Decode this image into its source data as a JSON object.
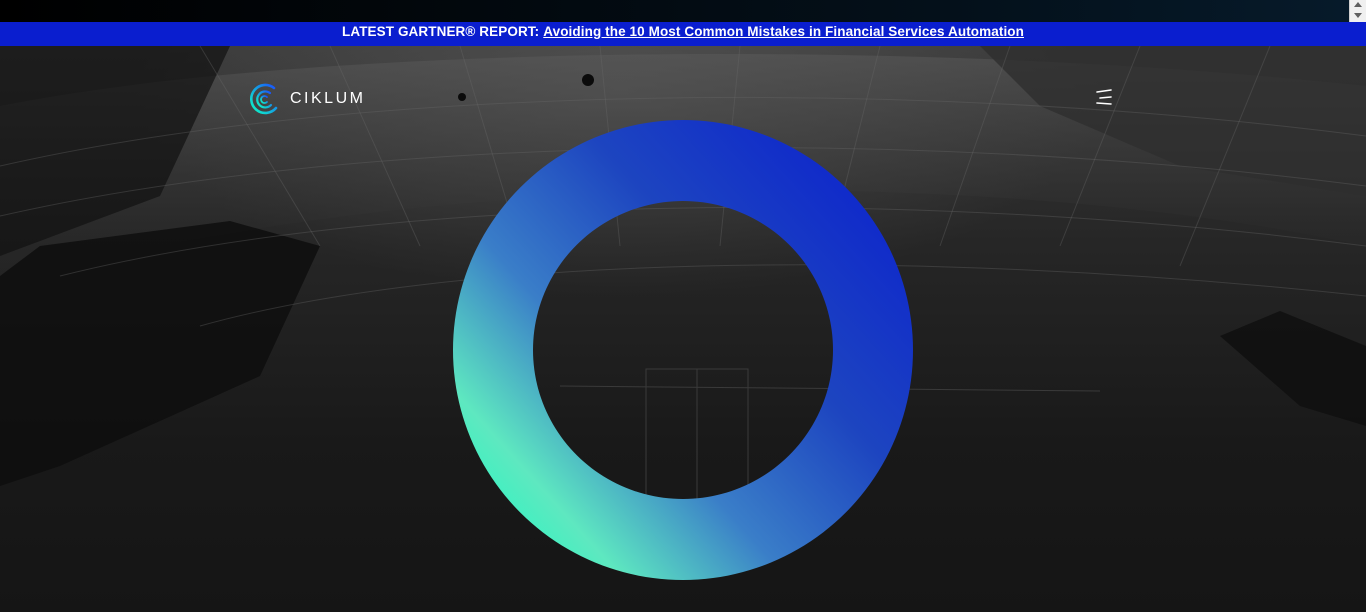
{
  "banner": {
    "prefix": "LATEST GARTNER® REPORT:",
    "link": "Avoiding the 10 Most Common Mistakes in Financial Services Automation"
  },
  "header": {
    "logo_text": "CIKLUM",
    "logo_icon": "ciklum-logo-icon",
    "menu_icon": "menu-icon"
  },
  "hero": {
    "ring_icon": "gradient-ring-graphic"
  },
  "colors": {
    "banner_bg": "#0a1ecf",
    "ring_start": "#0dffc3",
    "ring_end": "#0a1ecf",
    "page_bg": "#151515"
  }
}
